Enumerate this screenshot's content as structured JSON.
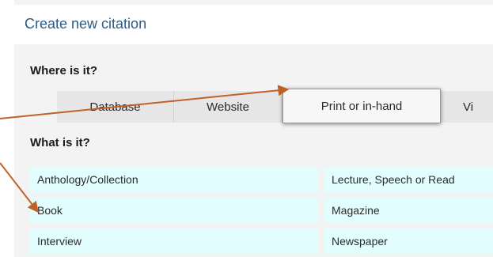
{
  "header": {
    "title": "Create new citation"
  },
  "where": {
    "label": "Where is it?",
    "tabs": [
      "Database",
      "Website",
      "Print or in-hand",
      "Vi"
    ],
    "selected": "Print or in-hand"
  },
  "what": {
    "label": "What is it?",
    "left_items": [
      "Anthology/Collection",
      "Book",
      "Interview"
    ],
    "right_items": [
      "Lecture, Speech or Read",
      "Magazine",
      "Newspaper"
    ]
  },
  "colors": {
    "header_text": "#2e5a86",
    "cell_bg": "#e2fdfd",
    "arrow": "#c0612b"
  }
}
